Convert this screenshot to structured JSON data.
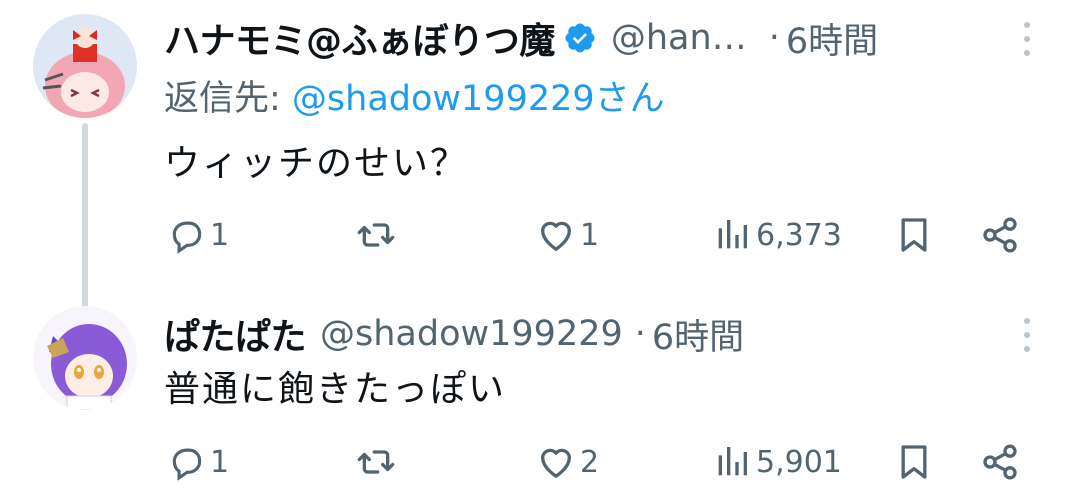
{
  "tweets": [
    {
      "display_name": "ハナモミ@ふぁぼりつ魔",
      "verified": true,
      "handle": "@han…",
      "separator": "·",
      "time": "6時間",
      "reply_label": "返信先: ",
      "reply_mention": "@shadow199229さん",
      "text": "ウィッチのせい？",
      "replies": "1",
      "retweets": "",
      "likes": "1",
      "views": "6,373"
    },
    {
      "display_name": "ぱたぱた",
      "handle": "@shadow199229",
      "separator": "·",
      "time": "6時間",
      "text": "普通に飽きたっぽい",
      "replies": "1",
      "retweets": "",
      "likes": "2",
      "views": "5,901"
    }
  ],
  "colors": {
    "text_primary": "#0f1419",
    "text_secondary": "#536471",
    "accent": "#1d9bf0",
    "thread_line": "#cfd9de"
  },
  "icons": [
    "more-icon",
    "verified-badge-icon",
    "reply-icon",
    "retweet-icon",
    "like-icon",
    "views-icon",
    "bookmark-icon",
    "share-icon"
  ]
}
